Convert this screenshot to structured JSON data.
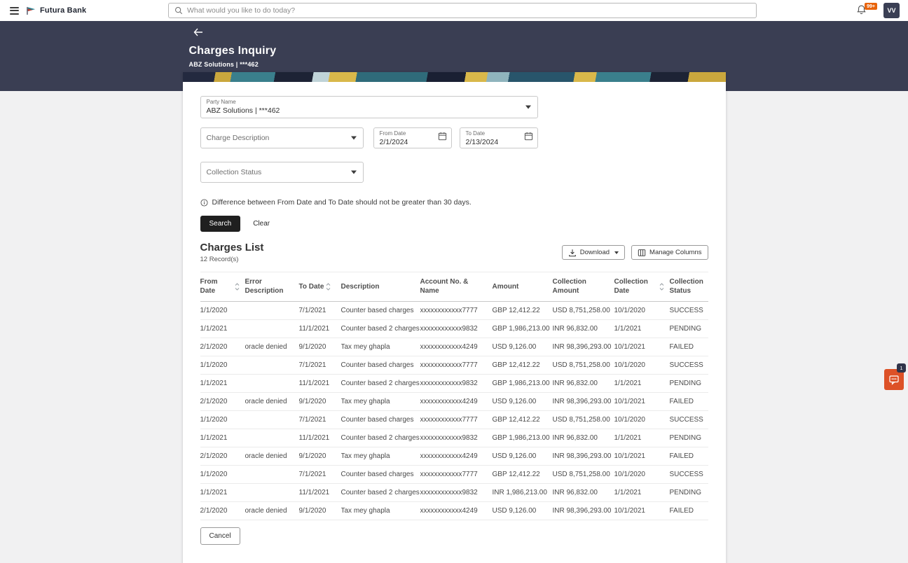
{
  "topbar": {
    "brand": "Futura Bank",
    "search_placeholder": "What would you like to do today?",
    "notification_badge": "99+",
    "avatar_initials": "VV"
  },
  "header": {
    "title": "Charges Inquiry",
    "subtitle": "ABZ Solutions | ***462"
  },
  "filters": {
    "party_name": {
      "label": "Party Name",
      "value": "ABZ Solutions | ***462"
    },
    "charge_description": {
      "placeholder": "Charge Description"
    },
    "from_date": {
      "label": "From Date",
      "value": "2/1/2024"
    },
    "to_date": {
      "label": "To Date",
      "value": "2/13/2024"
    },
    "collection_status": {
      "placeholder": "Collection Status"
    },
    "note": "Difference between From Date and To Date should not be greater than 30 days.",
    "search_label": "Search",
    "clear_label": "Clear"
  },
  "charges_list": {
    "title": "Charges List",
    "record_count": "12 Record(s)",
    "download_label": "Download",
    "manage_columns_label": "Manage Columns",
    "cancel_label": "Cancel",
    "columns": [
      "From Date",
      "Error Description",
      "To Date",
      "Description",
      "Account No. & Name",
      "Amount",
      "Collection Amount",
      "Collection Date",
      "Collection Status"
    ],
    "rows": [
      [
        "1/1/2020",
        "",
        "7/1/2021",
        "Counter based charges",
        "xxxxxxxxxxxx7777",
        "GBP 12,412.22",
        "USD 8,751,258.00",
        "10/1/2020",
        "SUCCESS"
      ],
      [
        "1/1/2021",
        "",
        "11/1/2021",
        "Counter based 2 charges",
        "xxxxxxxxxxxx9832",
        "GBP 1,986,213.00",
        "INR 96,832.00",
        "1/1/2021",
        "PENDING"
      ],
      [
        "2/1/2020",
        "oracle denied",
        "9/1/2020",
        "Tax mey ghapla",
        "xxxxxxxxxxxx4249",
        "USD 9,126.00",
        "INR 98,396,293.00",
        "10/1/2021",
        "FAILED"
      ],
      [
        "1/1/2020",
        "",
        "7/1/2021",
        "Counter based charges",
        "xxxxxxxxxxxx7777",
        "GBP 12,412.22",
        "USD 8,751,258.00",
        "10/1/2020",
        "SUCCESS"
      ],
      [
        "1/1/2021",
        "",
        "11/1/2021",
        "Counter based 2 charges",
        "xxxxxxxxxxxx9832",
        "GBP 1,986,213.00",
        "INR 96,832.00",
        "1/1/2021",
        "PENDING"
      ],
      [
        "2/1/2020",
        "oracle denied",
        "9/1/2020",
        "Tax mey ghapla",
        "xxxxxxxxxxxx4249",
        "USD 9,126.00",
        "INR 98,396,293.00",
        "10/1/2021",
        "FAILED"
      ],
      [
        "1/1/2020",
        "",
        "7/1/2021",
        "Counter based charges",
        "xxxxxxxxxxxx7777",
        "GBP 12,412.22",
        "USD 8,751,258.00",
        "10/1/2020",
        "SUCCESS"
      ],
      [
        "1/1/2021",
        "",
        "11/1/2021",
        "Counter based 2 charges",
        "xxxxxxxxxxxx9832",
        "GBP 1,986,213.00",
        "INR 96,832.00",
        "1/1/2021",
        "PENDING"
      ],
      [
        "2/1/2020",
        "oracle denied",
        "9/1/2020",
        "Tax mey ghapla",
        "xxxxxxxxxxxx4249",
        "USD 9,126.00",
        "INR 98,396,293.00",
        "10/1/2021",
        "FAILED"
      ],
      [
        "1/1/2020",
        "",
        "7/1/2021",
        "Counter based charges",
        "xxxxxxxxxxxx7777",
        "GBP 12,412.22",
        "USD 8,751,258.00",
        "10/1/2020",
        "SUCCESS"
      ],
      [
        "1/1/2021",
        "",
        "11/1/2021",
        "Counter based 2 charges",
        "xxxxxxxxxxxx9832",
        "INR 1,986,213.00",
        "INR 96,832.00",
        "1/1/2021",
        "PENDING"
      ],
      [
        "2/1/2020",
        "oracle denied",
        "9/1/2020",
        "Tax mey ghapla",
        "xxxxxxxxxxxx4249",
        "USD 9,126.00",
        "INR 98,396,293.00",
        "10/1/2021",
        "FAILED"
      ]
    ]
  },
  "chat": {
    "badge": "1"
  },
  "colors": {
    "header_bg": "#3a3e53",
    "search_button": "#1f1f1f",
    "chat_orange": "#dd5127",
    "notification_orange": "#e8630a",
    "page_bg": "#f1f1f2"
  }
}
